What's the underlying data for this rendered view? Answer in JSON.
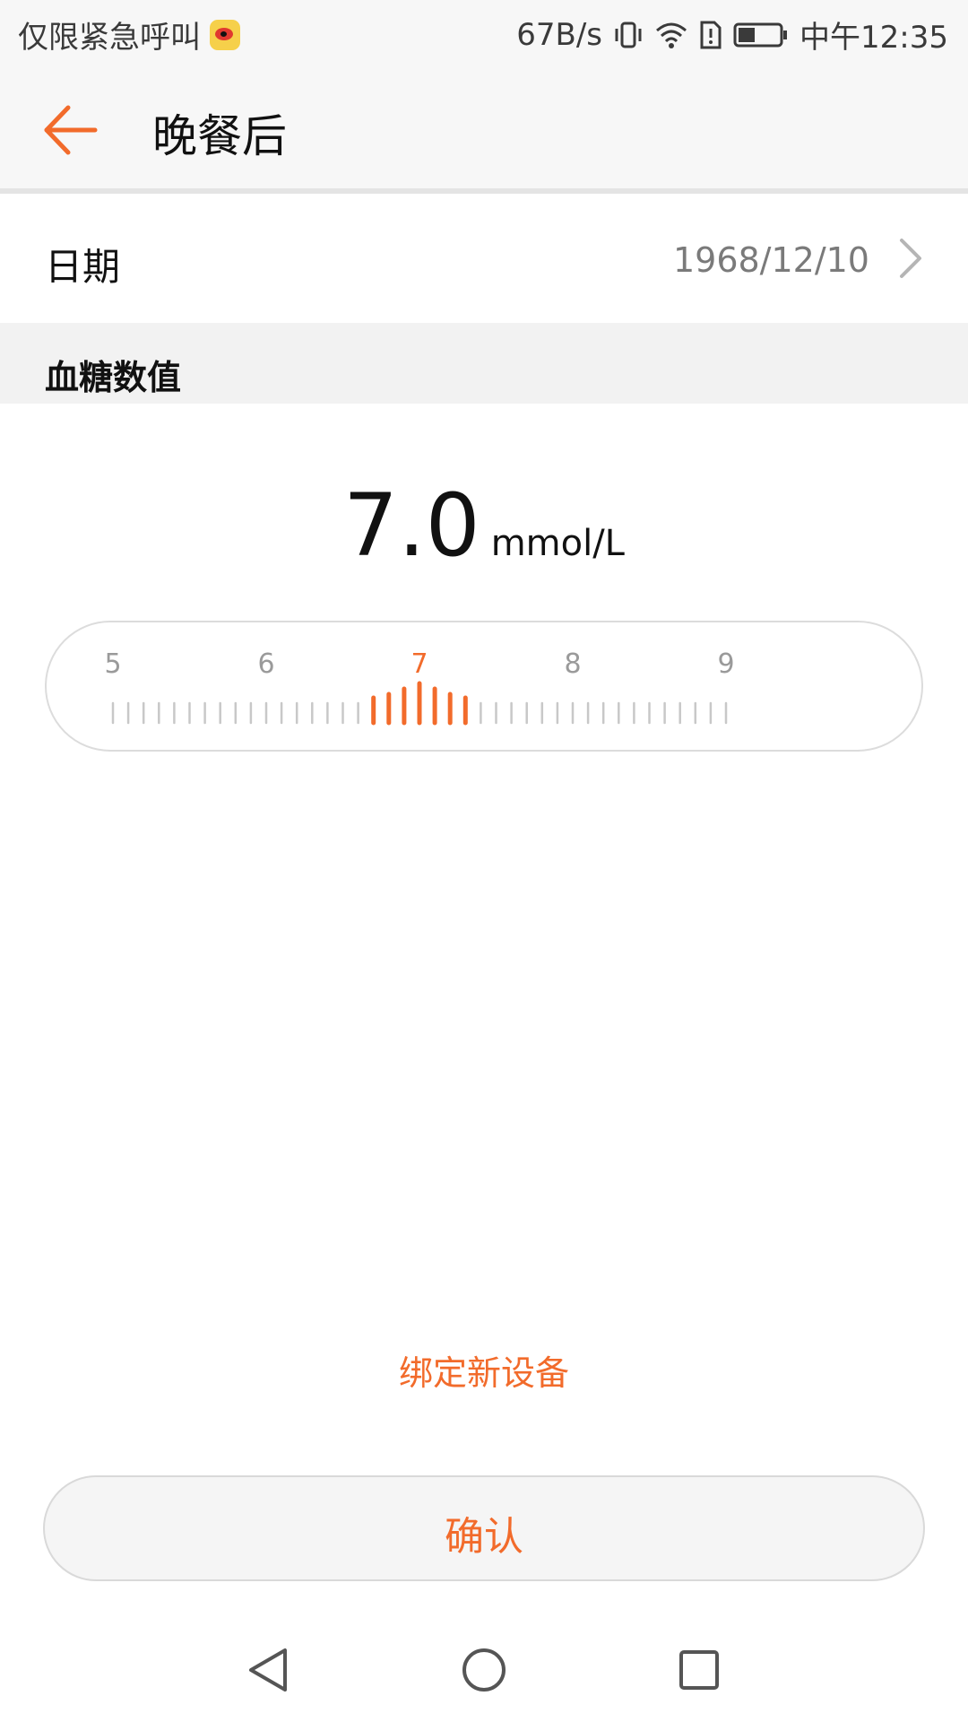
{
  "status_bar": {
    "left_text": "仅限紧急呼叫",
    "speed": "67B/s",
    "time": "中午12:35",
    "icons": [
      "weibo-icon",
      "vibrate-icon",
      "wifi-icon",
      "alert-icon",
      "battery-icon"
    ]
  },
  "app_bar": {
    "title": "晚餐后",
    "back_icon": "back-arrow-icon"
  },
  "date_row": {
    "label": "日期",
    "value": "1968/12/10",
    "chevron_icon": "chevron-right-icon"
  },
  "section": {
    "label": "血糖数值"
  },
  "reading": {
    "value": "7.0",
    "unit": "mmol/L"
  },
  "ruler": {
    "min": 5,
    "max": 9,
    "selected": 7.0,
    "major_labels": [
      "5",
      "6",
      "7",
      "8",
      "9"
    ],
    "step": 0.1,
    "accent_color": "#f26b2b",
    "tick_color": "#c8c8c8"
  },
  "bind_link": {
    "label": "绑定新设备"
  },
  "confirm": {
    "label": "确认"
  },
  "nav_bar": {
    "icons": [
      "nav-back-icon",
      "nav-home-icon",
      "nav-recents-icon"
    ]
  },
  "colors": {
    "accent": "#f26b2b",
    "header_bg": "#f7f7f7",
    "section_bg": "#f2f2f2"
  }
}
